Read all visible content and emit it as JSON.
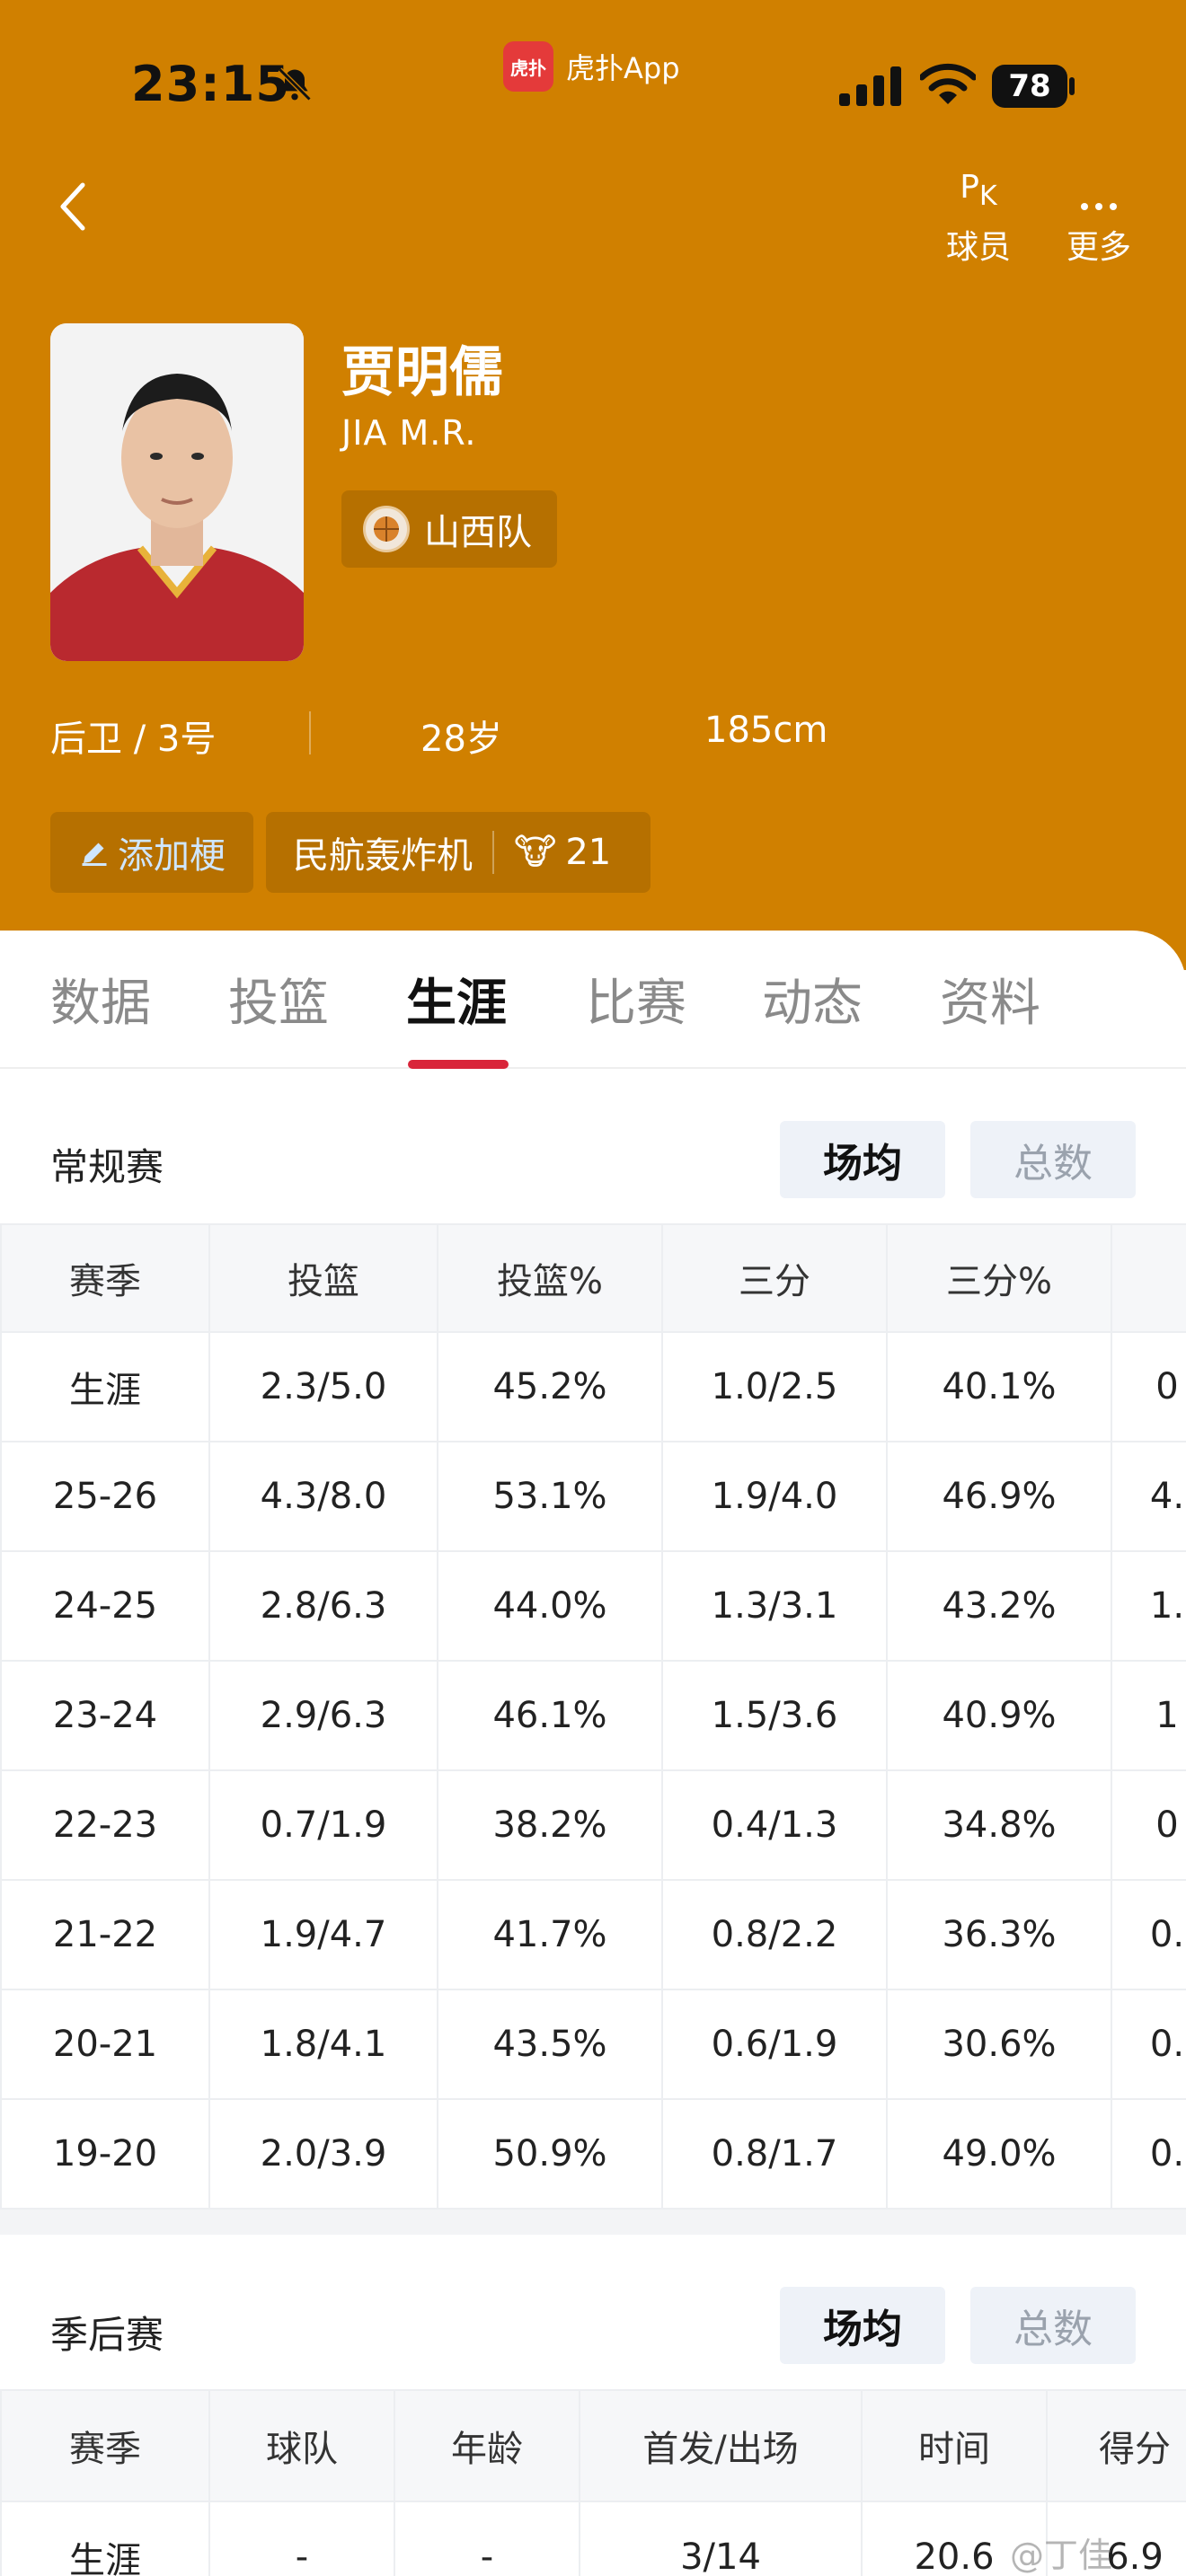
{
  "status_bar": {
    "time": "23:15",
    "app_label": "虎扑App",
    "app_logo_text": "虎扑",
    "battery": "78"
  },
  "nav": {
    "pk_main": "P",
    "pk_sub": "K",
    "players_label": "球员",
    "more_label": "更多"
  },
  "player": {
    "name": "贾明儒",
    "pinyin": "JIA M.R.",
    "team": "山西队",
    "position_number": "后卫 / 3号",
    "age": "28岁",
    "height": "185cm",
    "add_tag_label": "添加梗",
    "nickname": "民航轰炸机",
    "nickname_votes": "21"
  },
  "tabs": [
    "数据",
    "投篮",
    "生涯",
    "比赛",
    "动态",
    "资料"
  ],
  "active_tab": "生涯",
  "regular": {
    "title": "常规赛",
    "toggle_avg": "场均",
    "toggle_total": "总数",
    "columns": [
      "赛季",
      "投篮",
      "投篮%",
      "三分",
      "三分%",
      ""
    ],
    "rows": [
      [
        "生涯",
        "2.3/5.0",
        "45.2%",
        "1.0/2.5",
        "40.1%",
        "0"
      ],
      [
        "25-26",
        "4.3/8.0",
        "53.1%",
        "1.9/4.0",
        "46.9%",
        "4."
      ],
      [
        "24-25",
        "2.8/6.3",
        "44.0%",
        "1.3/3.1",
        "43.2%",
        "1."
      ],
      [
        "23-24",
        "2.9/6.3",
        "46.1%",
        "1.5/3.6",
        "40.9%",
        "1"
      ],
      [
        "22-23",
        "0.7/1.9",
        "38.2%",
        "0.4/1.3",
        "34.8%",
        "0"
      ],
      [
        "21-22",
        "1.9/4.7",
        "41.7%",
        "0.8/2.2",
        "36.3%",
        "0."
      ],
      [
        "20-21",
        "1.8/4.1",
        "43.5%",
        "0.6/1.9",
        "30.6%",
        "0."
      ],
      [
        "19-20",
        "2.0/3.9",
        "50.9%",
        "0.8/1.7",
        "49.0%",
        "0."
      ]
    ]
  },
  "playoffs": {
    "title": "季后赛",
    "toggle_avg": "场均",
    "toggle_total": "总数",
    "columns": [
      "赛季",
      "球队",
      "年龄",
      "首发/出场",
      "时间",
      "得分"
    ],
    "rows": [
      [
        "生涯",
        "-",
        "-",
        "3/14",
        "20.6",
        "6.9"
      ]
    ]
  },
  "watermark": "@丁佳"
}
